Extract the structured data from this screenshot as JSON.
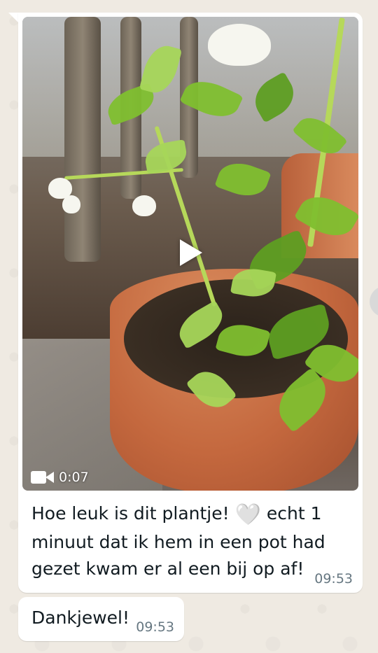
{
  "message": {
    "video_duration": "0:07",
    "text_before_emoji": "Hoe leuk is dit plantje! ",
    "emoji": "🤍",
    "text_after_emoji": " echt 1\nminuut dat ik hem in een pot had\ngezet kwam er al een bij op af!",
    "time": "09:53"
  },
  "reply": {
    "text": "Dankjewel!",
    "time": "09:53"
  },
  "icons": {
    "play": "play-icon",
    "video": "video-camera-icon"
  }
}
